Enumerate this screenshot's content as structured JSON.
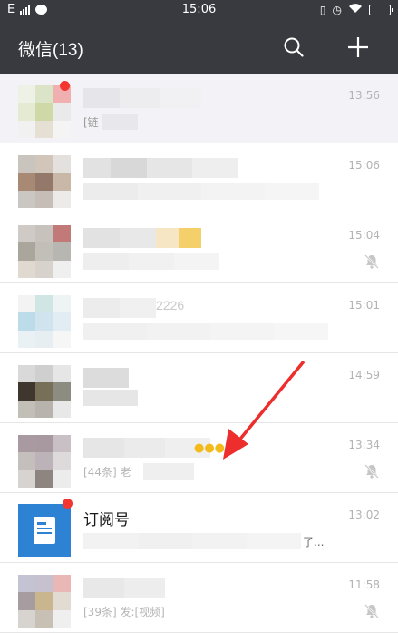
{
  "status_bar": {
    "network": "E",
    "time": "15:06"
  },
  "nav": {
    "title": "微信(13)",
    "search_icon": "search-icon",
    "add_icon": "plus-icon"
  },
  "chats": [
    {
      "time": "13:56",
      "msg_fragment": "[链",
      "pinned": true,
      "muted": false
    },
    {
      "time": "15:06",
      "msg_fragment": "",
      "pinned": false,
      "muted": false
    },
    {
      "time": "15:04",
      "msg_fragment": "",
      "pinned": false,
      "muted": true
    },
    {
      "time": "15:01",
      "name_fragment": "2226",
      "msg_fragment": "",
      "pinned": false,
      "muted": false
    },
    {
      "time": "14:59",
      "msg_fragment": "",
      "pinned": false,
      "muted": false
    },
    {
      "time": "13:34",
      "msg_fragment": "[44条] 老",
      "pinned": false,
      "muted": true
    },
    {
      "time": "13:02",
      "name": "订阅号",
      "msg_tail": "了...",
      "pinned": false,
      "muted": false
    },
    {
      "time": "11:58",
      "msg_fragment": "[39条] 发:[视频]",
      "pinned": false,
      "muted": true
    }
  ],
  "colors": {
    "header_bg": "#393a3f",
    "accent_red": "#f43530",
    "subscription_blue": "#2d82d3"
  }
}
